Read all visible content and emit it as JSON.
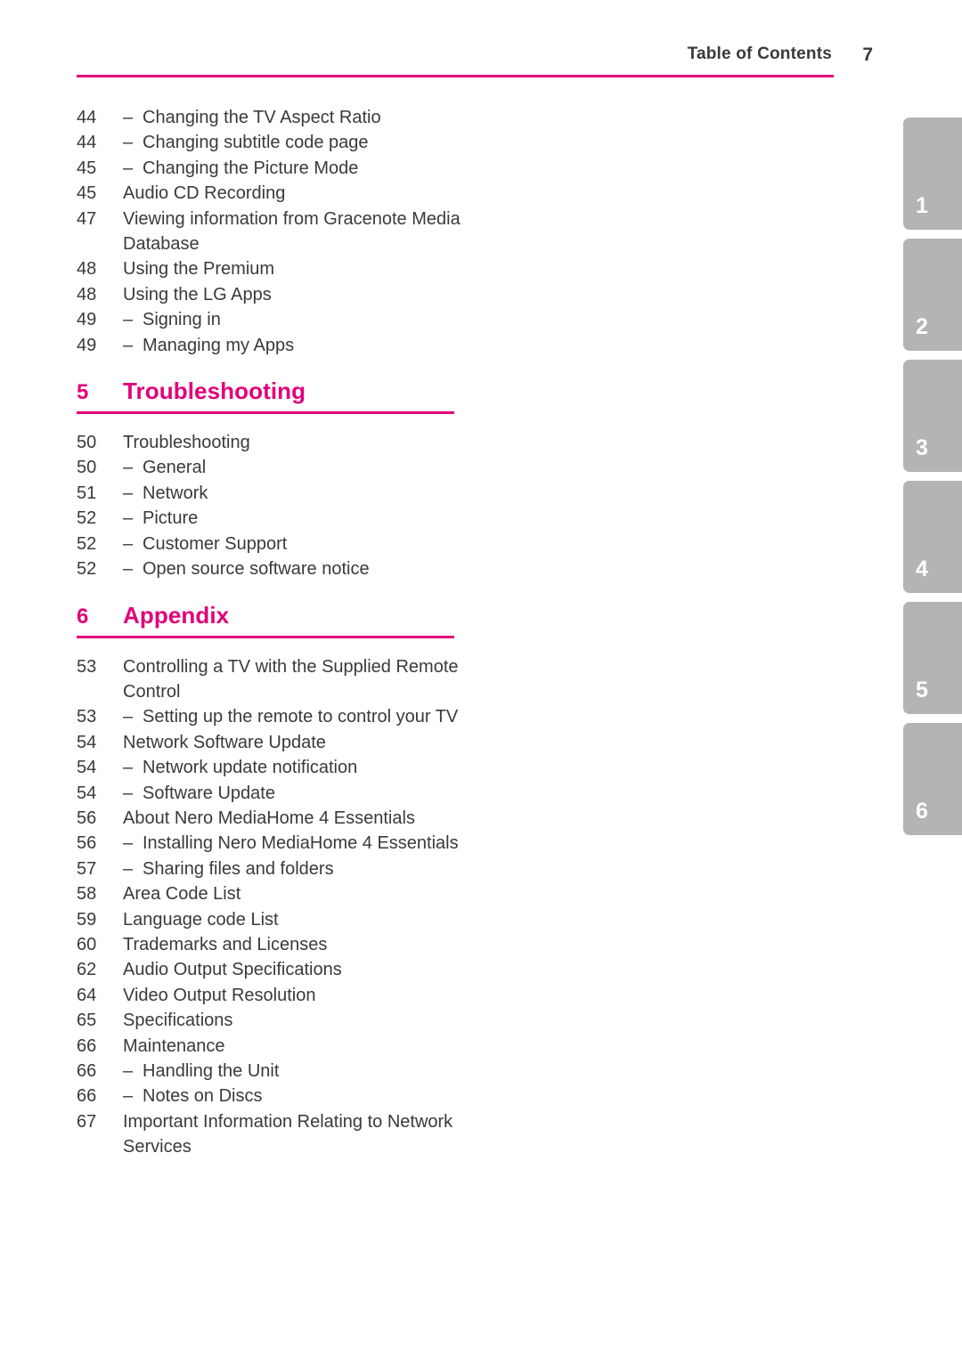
{
  "header": {
    "title": "Table of Contents",
    "page_number": "7",
    "rule_color": "#e2007a"
  },
  "colors": {
    "accent_pink": "#e2007a",
    "body_text": "#3a3a3a",
    "tab_gray": "#b4b4b4",
    "tab_number": "#ffffff"
  },
  "toc": {
    "leading_entries": [
      {
        "page": "44",
        "dash": "–",
        "label": "Changing the TV Aspect Ratio",
        "sub": true
      },
      {
        "page": "44",
        "dash": "–",
        "label": "Changing subtitle code page",
        "sub": true
      },
      {
        "page": "45",
        "dash": "–",
        "label": "Changing the Picture Mode",
        "sub": true
      },
      {
        "page": "45",
        "dash": "",
        "label": "Audio CD Recording",
        "sub": false
      },
      {
        "page": "47",
        "dash": "",
        "label": "Viewing information from Gracenote Media Database",
        "sub": false
      },
      {
        "page": "48",
        "dash": "",
        "label": "Using the Premium",
        "sub": false
      },
      {
        "page": "48",
        "dash": "",
        "label": "Using the LG Apps",
        "sub": false
      },
      {
        "page": "49",
        "dash": "–",
        "label": "Signing in",
        "sub": true
      },
      {
        "page": "49",
        "dash": "–",
        "label": "Managing my Apps",
        "sub": true
      }
    ],
    "sections": [
      {
        "number": "5",
        "title": "Troubleshooting",
        "entries": [
          {
            "page": "50",
            "dash": "",
            "label": "Troubleshooting",
            "sub": false
          },
          {
            "page": "50",
            "dash": "–",
            "label": "General",
            "sub": true
          },
          {
            "page": "51",
            "dash": "–",
            "label": "Network",
            "sub": true
          },
          {
            "page": "52",
            "dash": "–",
            "label": "Picture",
            "sub": true
          },
          {
            "page": "52",
            "dash": "–",
            "label": "Customer Support",
            "sub": true
          },
          {
            "page": "52",
            "dash": "–",
            "label": "Open source software notice",
            "sub": true
          }
        ]
      },
      {
        "number": "6",
        "title": "Appendix",
        "entries": [
          {
            "page": "53",
            "dash": "",
            "label": "Controlling a TV with the Supplied Remote Control",
            "sub": false
          },
          {
            "page": "53",
            "dash": "–",
            "label": "Setting up the remote to control your TV",
            "sub": true
          },
          {
            "page": "54",
            "dash": "",
            "label": "Network Software Update",
            "sub": false
          },
          {
            "page": "54",
            "dash": "–",
            "label": "Network update notification",
            "sub": true
          },
          {
            "page": "54",
            "dash": "–",
            "label": "Software Update",
            "sub": true
          },
          {
            "page": "56",
            "dash": "",
            "label": "About Nero MediaHome 4 Essentials",
            "sub": false
          },
          {
            "page": "56",
            "dash": "–",
            "label": "Installing Nero MediaHome 4 Essentials",
            "sub": true
          },
          {
            "page": "57",
            "dash": "–",
            "label": "Sharing files and folders",
            "sub": true
          },
          {
            "page": "58",
            "dash": "",
            "label": "Area Code List",
            "sub": false
          },
          {
            "page": "59",
            "dash": "",
            "label": "Language code List",
            "sub": false
          },
          {
            "page": "60",
            "dash": "",
            "label": "Trademarks and Licenses",
            "sub": false
          },
          {
            "page": "62",
            "dash": "",
            "label": "Audio Output Specifications",
            "sub": false
          },
          {
            "page": "64",
            "dash": "",
            "label": "Video Output Resolution",
            "sub": false
          },
          {
            "page": "65",
            "dash": "",
            "label": "Specifications",
            "sub": false
          },
          {
            "page": "66",
            "dash": "",
            "label": "Maintenance",
            "sub": false
          },
          {
            "page": "66",
            "dash": "–",
            "label": "Handling the Unit",
            "sub": true
          },
          {
            "page": "66",
            "dash": "–",
            "label": "Notes on Discs",
            "sub": true
          },
          {
            "page": "67",
            "dash": "",
            "label": "Important Information Relating to Network Services",
            "sub": false
          }
        ]
      }
    ]
  },
  "chapter_tabs": [
    {
      "number": "1"
    },
    {
      "number": "2"
    },
    {
      "number": "3"
    },
    {
      "number": "4"
    },
    {
      "number": "5"
    },
    {
      "number": "6"
    }
  ]
}
